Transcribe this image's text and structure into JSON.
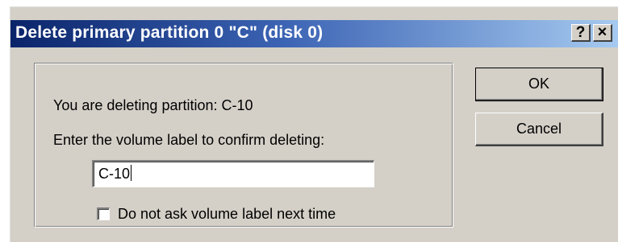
{
  "dialog": {
    "title": "Delete primary partition 0  \"C\" (disk 0)",
    "help_button": "?",
    "close_button": "×",
    "deleting_label": "You are deleting partition:  C-10",
    "confirm_label": "Enter the volume label to confirm deleting:",
    "volume_input_value": "C-10",
    "checkbox_label": "Do not ask volume label next time",
    "checkbox_checked": false,
    "ok_label": "OK",
    "cancel_label": "Cancel"
  }
}
